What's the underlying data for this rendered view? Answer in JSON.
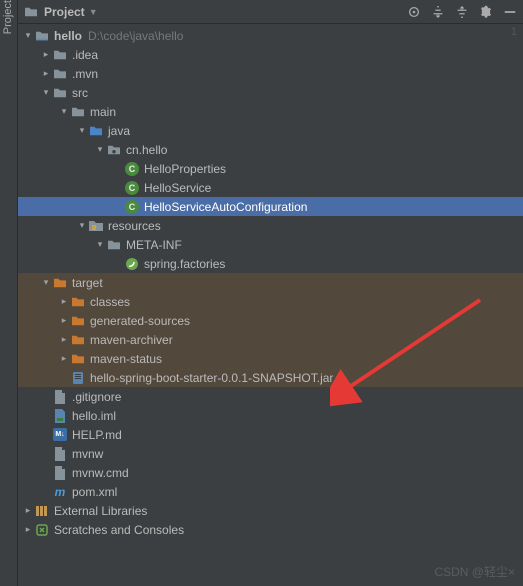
{
  "vertical_tab": "Project",
  "header": {
    "title": "Project",
    "icons": {
      "locate": "locate-icon",
      "expand": "expand-all-icon",
      "collapse": "collapse-all-icon",
      "settings": "gear-icon",
      "hide": "hide-icon"
    }
  },
  "gutter": {
    "num": "1"
  },
  "tree": {
    "root": {
      "name": "hello",
      "path": "D:\\code\\java\\hello",
      "children": {
        "idea": ".idea",
        "mvn": ".mvn",
        "src": {
          "label": "src",
          "main": {
            "label": "main",
            "java": {
              "label": "java",
              "pkg": {
                "label": "cn.hello",
                "classes": [
                  "HelloProperties",
                  "HelloService",
                  "HelloServiceAutoConfiguration"
                ]
              }
            },
            "resources": {
              "label": "resources",
              "metainf": {
                "label": "META-INF",
                "file": "spring.factories"
              }
            }
          }
        },
        "target": {
          "label": "target",
          "folders": [
            "classes",
            "generated-sources",
            "maven-archiver",
            "maven-status"
          ],
          "jar": "hello-spring-boot-starter-0.0.1-SNAPSHOT.jar"
        },
        "files": {
          "gitignore": ".gitignore",
          "helloiml": "hello.iml",
          "helpmd": "HELP.md",
          "mvnw": "mvnw",
          "mvnwcmd": "mvnw.cmd",
          "pomxml": "pom.xml"
        }
      }
    },
    "extlib": "External Libraries",
    "scratches": "Scratches and Consoles"
  },
  "watermarks": {
    "csdn": "CSDN @轻尘×",
    "blog": ""
  }
}
